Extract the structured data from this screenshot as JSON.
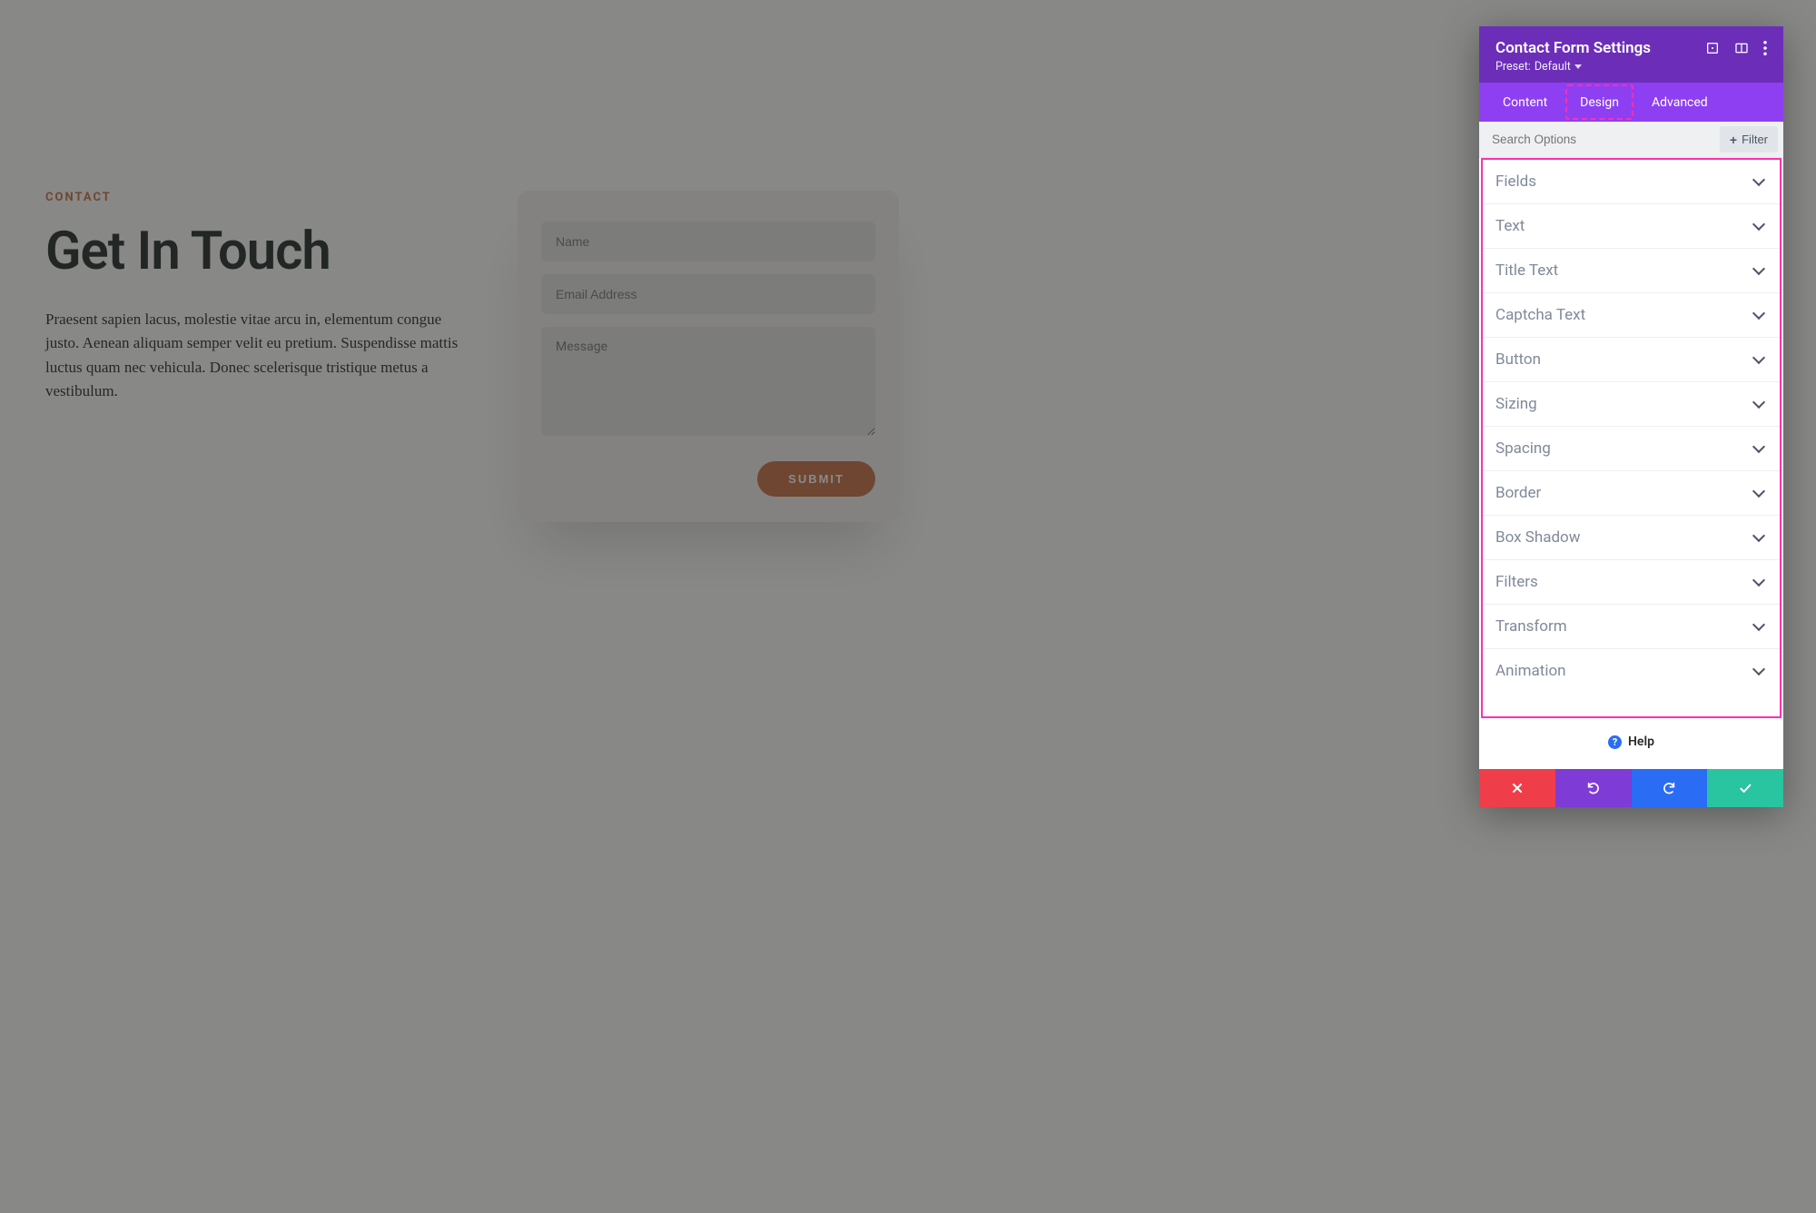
{
  "canvas": {
    "eyebrow": "CONTACT",
    "headline": "Get In Touch",
    "body": "Praesent sapien lacus, molestie vitae arcu in, elementum congue justo. Aenean aliquam semper velit eu pretium. Suspendisse mattis luctus quam nec vehicula. Donec scelerisque tristique metus a vestibulum.",
    "form": {
      "name_ph": "Name",
      "email_ph": "Email Address",
      "message_ph": "Message",
      "submit_label": "SUBMIT"
    }
  },
  "panel": {
    "title": "Contact Form Settings",
    "preset_prefix": "Preset:",
    "preset_value": "Default",
    "tabs": [
      "Content",
      "Design",
      "Advanced"
    ],
    "active_tab": "Design",
    "search_placeholder": "Search Options",
    "filter_label": "Filter",
    "options": [
      "Fields",
      "Text",
      "Title Text",
      "Captcha Text",
      "Button",
      "Sizing",
      "Spacing",
      "Border",
      "Box Shadow",
      "Filters",
      "Transform",
      "Animation"
    ],
    "help_label": "Help"
  }
}
